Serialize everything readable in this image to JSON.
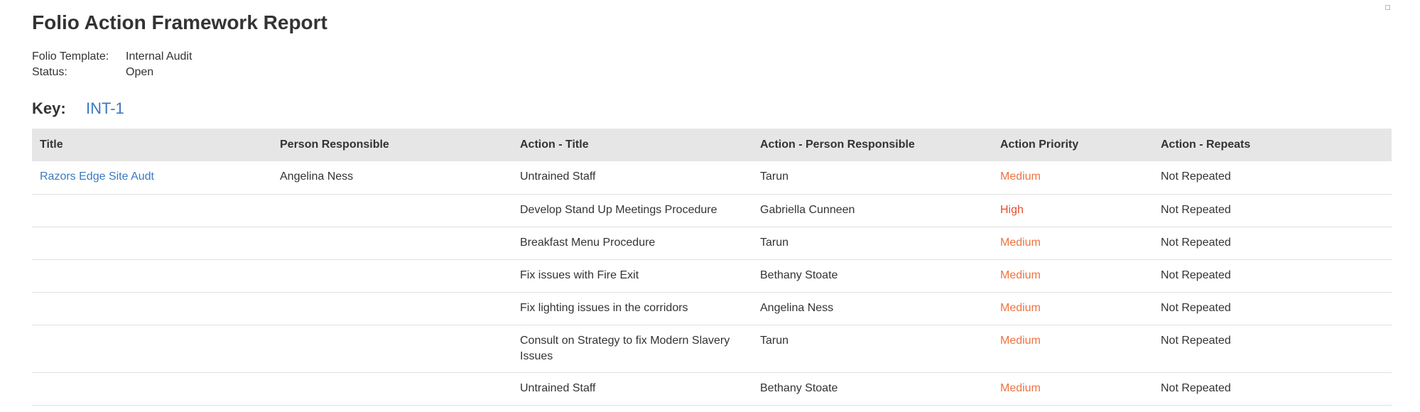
{
  "report": {
    "title": "Folio Action Framework Report",
    "meta": [
      {
        "label": "Folio Template:",
        "value": "Internal Audit"
      },
      {
        "label": "Status:",
        "value": "Open"
      }
    ],
    "key_label": "Key:",
    "key_value": "INT-1"
  },
  "table": {
    "headers": [
      "Title",
      "Person Responsible",
      "Action - Title",
      "Action - Person Responsible",
      "Action Priority",
      "Action - Repeats"
    ],
    "rows": [
      {
        "title": "Razors Edge Site Audt",
        "person": "Angelina Ness",
        "action_title": "Untrained Staff",
        "action_person": "Tarun",
        "priority": "Medium",
        "repeats": "Not Repeated"
      },
      {
        "title": "",
        "person": "",
        "action_title": "Develop Stand Up Meetings Procedure",
        "action_person": "Gabriella Cunneen",
        "priority": "High",
        "repeats": "Not Repeated"
      },
      {
        "title": "",
        "person": "",
        "action_title": "Breakfast Menu Procedure",
        "action_person": "Tarun",
        "priority": "Medium",
        "repeats": "Not Repeated"
      },
      {
        "title": "",
        "person": "",
        "action_title": "Fix issues with Fire Exit",
        "action_person": "Bethany Stoate",
        "priority": "Medium",
        "repeats": "Not Repeated"
      },
      {
        "title": "",
        "person": "",
        "action_title": "Fix lighting issues in the corridors",
        "action_person": "Angelina Ness",
        "priority": "Medium",
        "repeats": "Not Repeated"
      },
      {
        "title": "",
        "person": "",
        "action_title": "Consult on Strategy to fix Modern Slavery Issues",
        "action_person": "Tarun",
        "priority": "Medium",
        "repeats": "Not Repeated"
      },
      {
        "title": "",
        "person": "",
        "action_title": "Untrained Staff",
        "action_person": "Bethany Stoate",
        "priority": "Medium",
        "repeats": "Not Repeated"
      }
    ]
  },
  "colors": {
    "link": "#3a7abf",
    "priority_medium": "#f0733f",
    "priority_high": "#e74d2a",
    "header_bg": "#e6e6e6"
  }
}
